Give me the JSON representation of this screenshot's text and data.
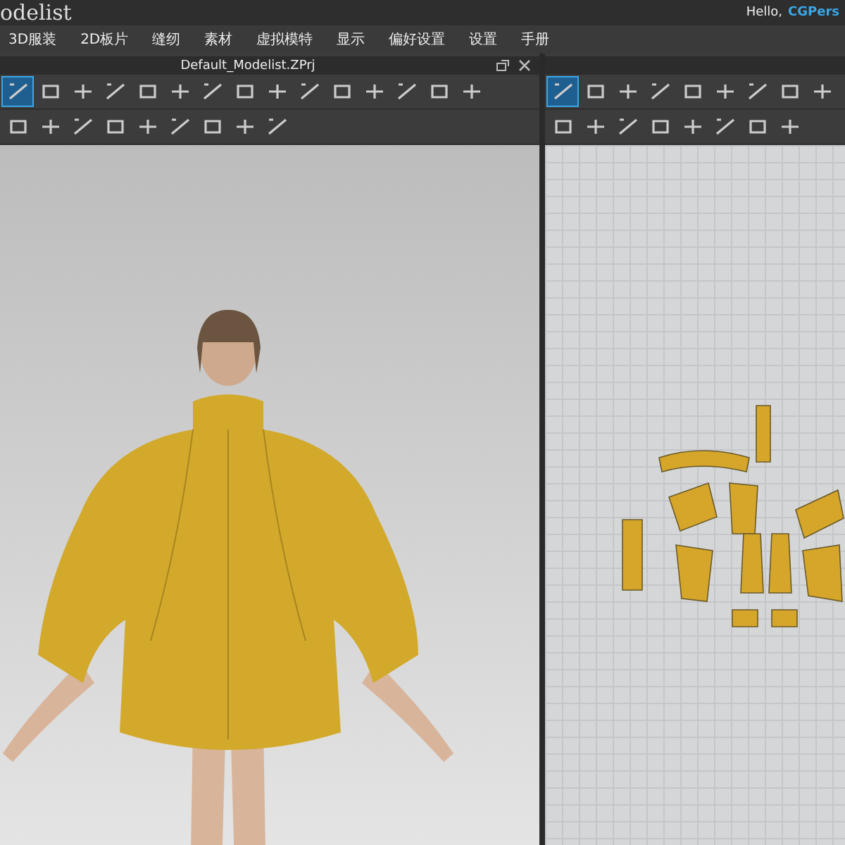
{
  "app": {
    "title": "odelist",
    "greeting": "Hello,",
    "user": "CGPers"
  },
  "menu": [
    {
      "label": "3D服装"
    },
    {
      "label": "2D板片"
    },
    {
      "label": "缝纫"
    },
    {
      "label": "素材"
    },
    {
      "label": "虚拟模特"
    },
    {
      "label": "显示"
    },
    {
      "label": "偏好设置"
    },
    {
      "label": "设置"
    },
    {
      "label": "手册"
    }
  ],
  "view_3d": {
    "title": "Default_Modelist.ZPrj",
    "toolbar_rows": [
      [
        {
          "selected": true
        },
        {
          "selected": false
        },
        {
          "selected": false
        },
        {
          "selected": false
        },
        {
          "selected": false
        },
        {
          "selected": false
        },
        {
          "selected": false
        },
        {
          "selected": false
        },
        {
          "selected": false
        },
        {
          "selected": false
        },
        {
          "selected": false
        },
        {
          "selected": false
        },
        {
          "selected": false
        },
        {
          "selected": false
        },
        {
          "selected": false
        }
      ],
      [
        {
          "selected": false
        },
        {
          "selected": false
        },
        {
          "selected": false
        },
        {
          "selected": false
        },
        {
          "selected": false
        },
        {
          "selected": false
        },
        {
          "selected": false
        },
        {
          "selected": false
        },
        {
          "selected": false
        }
      ]
    ]
  },
  "view_2d": {
    "toolbar_rows": [
      [
        {
          "selected": true
        },
        {
          "selected": false
        },
        {
          "selected": false
        },
        {
          "selected": false
        },
        {
          "selected": false
        },
        {
          "selected": false
        },
        {
          "selected": false
        },
        {
          "selected": false
        },
        {
          "selected": false
        }
      ],
      [
        {
          "selected": false
        },
        {
          "selected": false
        },
        {
          "selected": false
        },
        {
          "selected": false
        },
        {
          "selected": false
        },
        {
          "selected": false
        },
        {
          "selected": false
        },
        {
          "selected": false
        }
      ]
    ]
  }
}
